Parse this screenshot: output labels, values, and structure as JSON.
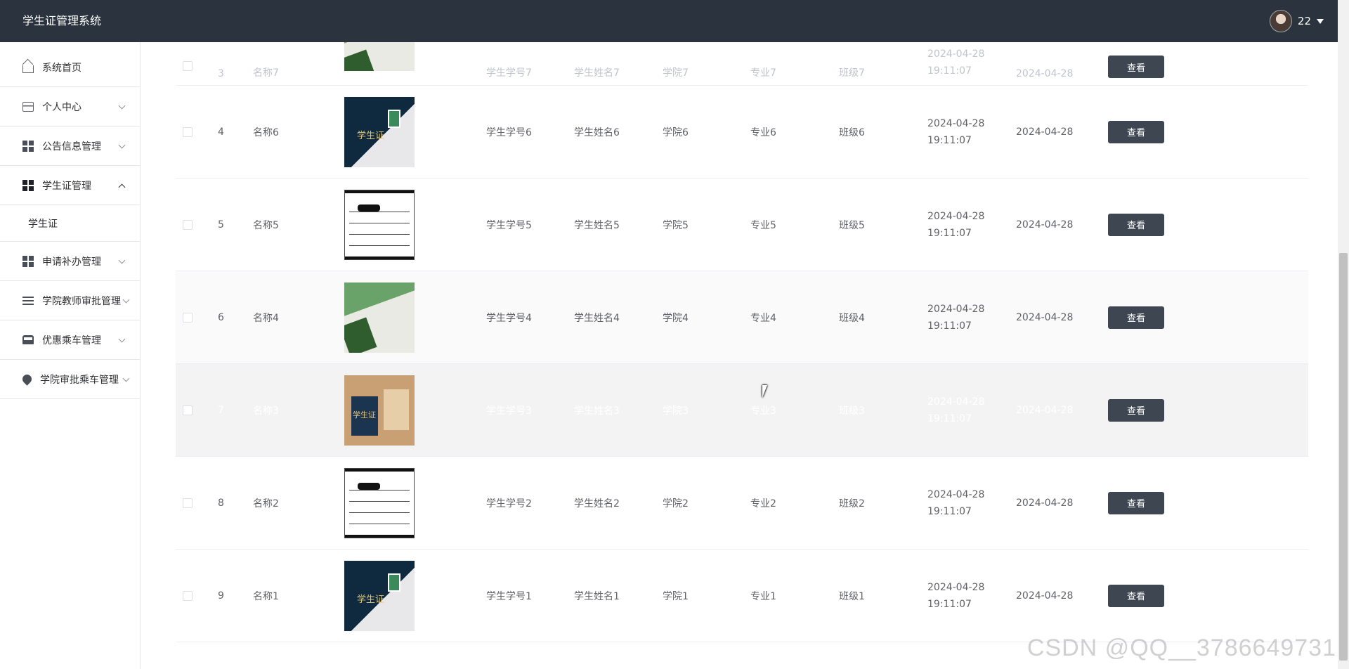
{
  "app": {
    "title": "学生证管理系统"
  },
  "user": {
    "name": "22"
  },
  "sidebar": {
    "items": [
      {
        "label": "系统首页"
      },
      {
        "label": "个人中心"
      },
      {
        "label": "公告信息管理"
      },
      {
        "label": "学生证管理"
      },
      {
        "label": "申请补办管理"
      },
      {
        "label": "学院教师审批管理"
      },
      {
        "label": "优惠乘车管理"
      },
      {
        "label": "学院审批乘车管理"
      }
    ],
    "submenu": {
      "label": "学生证"
    }
  },
  "table": {
    "view_label": "查看",
    "rows": [
      {
        "index": "3",
        "name": "名称7",
        "student_id": "学生学号7",
        "student_name": "学生姓名7",
        "college": "学院7",
        "major": "专业7",
        "class": "班级7",
        "time": "2024-04-28 19:11:07",
        "date": "2024-04-28"
      },
      {
        "index": "4",
        "name": "名称6",
        "student_id": "学生学号6",
        "student_name": "学生姓名6",
        "college": "学院6",
        "major": "专业6",
        "class": "班级6",
        "time": "2024-04-28 19:11:07",
        "date": "2024-04-28"
      },
      {
        "index": "5",
        "name": "名称5",
        "student_id": "学生学号5",
        "student_name": "学生姓名5",
        "college": "学院5",
        "major": "专业5",
        "class": "班级5",
        "time": "2024-04-28 19:11:07",
        "date": "2024-04-28"
      },
      {
        "index": "6",
        "name": "名称4",
        "student_id": "学生学号4",
        "student_name": "学生姓名4",
        "college": "学院4",
        "major": "专业4",
        "class": "班级4",
        "time": "2024-04-28 19:11:07",
        "date": "2024-04-28"
      },
      {
        "index": "7",
        "name": "名称3",
        "student_id": "学生学号3",
        "student_name": "学生姓名3",
        "college": "学院3",
        "major": "专业3",
        "class": "班级3",
        "time": "2024-04-28 19:11:07",
        "date": "2024-04-28"
      },
      {
        "index": "8",
        "name": "名称2",
        "student_id": "学生学号2",
        "student_name": "学生姓名2",
        "college": "学院2",
        "major": "专业2",
        "class": "班级2",
        "time": "2024-04-28 19:11:07",
        "date": "2024-04-28"
      },
      {
        "index": "9",
        "name": "名称1",
        "student_id": "学生学号1",
        "student_name": "学生姓名1",
        "college": "学院1",
        "major": "专业1",
        "class": "班级1",
        "time": "2024-04-28 19:11:07",
        "date": "2024-04-28"
      }
    ]
  },
  "watermark": "CSDN @QQ__3786649731",
  "colors": {
    "topbar": "#2b333e",
    "button": "#3e4651",
    "hover_row": "#f2f3f2"
  }
}
